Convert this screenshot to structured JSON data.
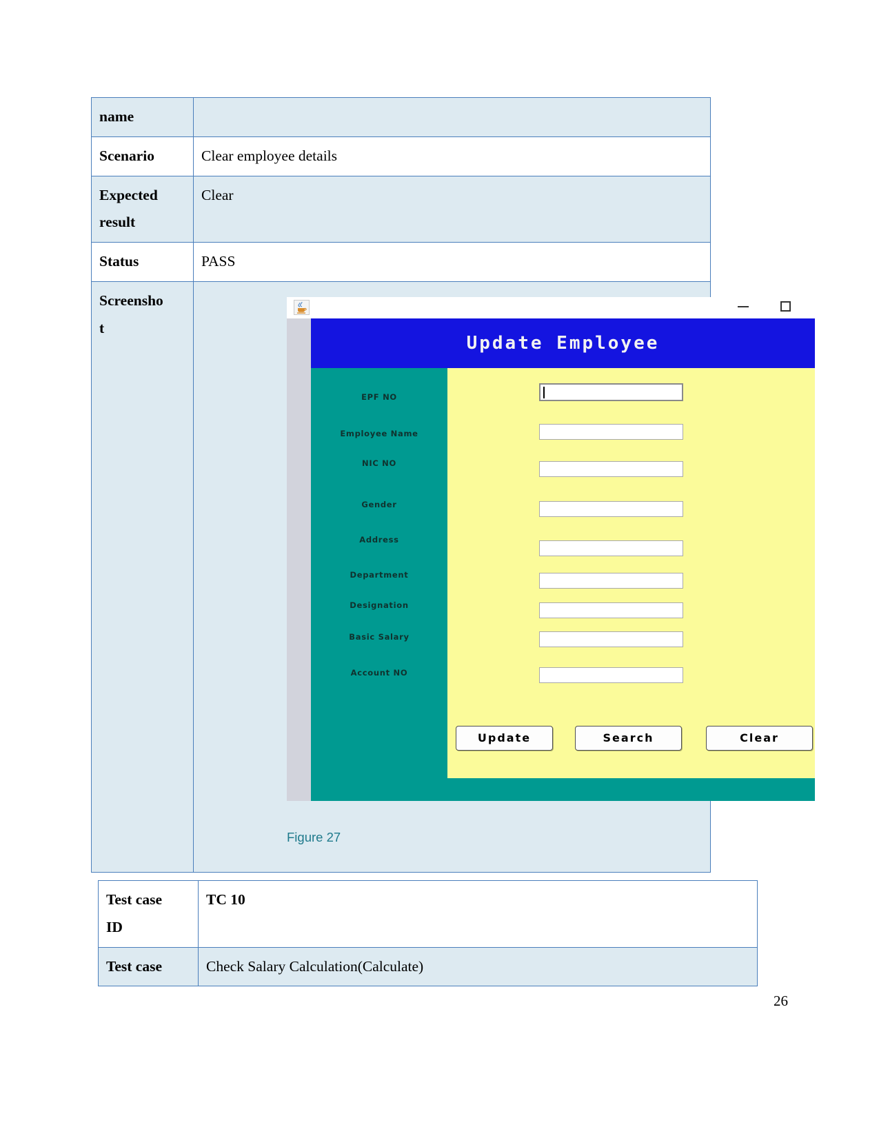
{
  "document": {
    "page_number": "26",
    "figure_caption": "Figure 27"
  },
  "test_case_table_1": {
    "rows": [
      {
        "label": "name",
        "value": ""
      },
      {
        "label": "Scenario",
        "value": "Clear employee details"
      },
      {
        "label": "Expected result",
        "label_line1": "Expected",
        "label_line2": "result",
        "value": "Clear"
      },
      {
        "label": "Status",
        "value": "PASS"
      },
      {
        "label": "Screenshot",
        "label_line1": "Screensho",
        "label_line2": "t",
        "value": ""
      }
    ]
  },
  "test_case_table_2": {
    "rows": [
      {
        "label_line1": "Test case",
        "label_line2": "ID",
        "value": "TC 10"
      },
      {
        "label_line1": "Test case",
        "label_line2": "",
        "value": "Check Salary Calculation(Calculate)"
      }
    ]
  },
  "screenshot_app": {
    "window": {
      "icon": "java-cup-icon",
      "minimize": "minimize-icon",
      "maximize": "maximize-icon"
    },
    "header_title": "Update Employee",
    "fields": [
      {
        "label": "EPF NO",
        "value": "",
        "focused": true
      },
      {
        "label": "Employee Name",
        "value": "",
        "focused": false
      },
      {
        "label": "NIC NO",
        "value": "",
        "focused": false
      },
      {
        "label": "Gender",
        "value": "",
        "focused": false
      },
      {
        "label": "Address",
        "value": "",
        "focused": false
      },
      {
        "label": "Department",
        "value": "",
        "focused": false
      },
      {
        "label": "Designation",
        "value": "",
        "focused": false
      },
      {
        "label": "Basic Salary",
        "value": "",
        "focused": false
      },
      {
        "label": "Account NO",
        "value": "",
        "focused": false
      }
    ],
    "buttons": [
      {
        "label": "Update"
      },
      {
        "label": "Search"
      },
      {
        "label": "Clear"
      }
    ],
    "colors": {
      "header_blue": "#1414e0",
      "panel_teal": "#009a91",
      "form_yellow": "#fbfb9a",
      "table_border": "#4a7ebb",
      "row_shade": "#ddeaf1",
      "caption_teal": "#1f7a8c"
    }
  }
}
